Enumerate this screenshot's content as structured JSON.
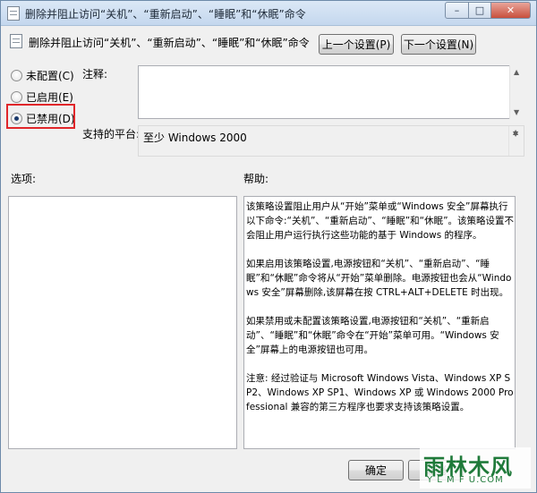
{
  "window": {
    "title": "删除并阻止访问“关机”、“重新启动”、“睡眠”和“休眠”命令",
    "caption": {
      "minimize": "–",
      "maximize": "□",
      "close": "✕"
    }
  },
  "header": {
    "policy_name": "删除并阻止访问“关机”、“重新启动”、“睡眠”和“休眠”命令",
    "prev_button": "上一个设置(P)",
    "next_button": "下一个设置(N)"
  },
  "radios": [
    {
      "label": "未配置(C)",
      "checked": false
    },
    {
      "label": "已启用(E)",
      "checked": false
    },
    {
      "label": "已禁用(D)",
      "checked": true
    }
  ],
  "labels": {
    "comment": "注释:",
    "platform": "支持的平台:",
    "options": "选项:",
    "help": "帮助:"
  },
  "comment_value": "",
  "platform_value": "至少 Windows 2000",
  "help_text": [
    "该策略设置阻止用户从“开始”菜单或“Windows 安全”屏幕执行以下命令:“关机”、“重新启动”、“睡眠”和“休眠”。该策略设置不会阻止用户运行执行这些功能的基于 Windows 的程序。",
    "如果启用该策略设置,电源按钮和“关机”、“重新启动”、“睡眠”和“休眠”命令将从“开始”菜单删除。电源按钮也会从“Windows 安全”屏幕删除,该屏幕在按 CTRL+ALT+DELETE 时出现。",
    "如果禁用或未配置该策略设置,电源按钮和“关机”、“重新启动”、“睡眠”和“休眠”命令在“开始”菜单可用。“Windows 安全”屏幕上的电源按钮也可用。",
    "注意: 经过验证与 Microsoft Windows Vista、Windows XP SP2、Windows XP SP1、Windows XP 或 Windows 2000 Professional 兼容的第三方程序也要求支持该策略设置。"
  ],
  "footer": {
    "ok_button": "确定",
    "cancel_button": "取消"
  },
  "watermark": {
    "main": "雨林木风",
    "sub": "Y L M F U.COM"
  }
}
